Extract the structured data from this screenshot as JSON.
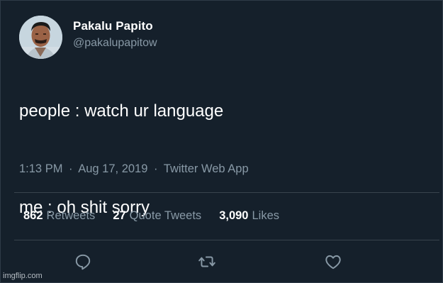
{
  "author": {
    "display_name": "Pakalu Papito",
    "handle": "@pakalupapitow"
  },
  "tweet": {
    "line1": "people : watch ur language",
    "line2": "me : oh shit sorry"
  },
  "meta": {
    "time": "1:13 PM",
    "separator": "·",
    "date": "Aug 17, 2019",
    "source": "Twitter Web App"
  },
  "stats": {
    "retweets_count": "862",
    "retweets_label": "Retweets",
    "quotes_count": "27",
    "quotes_label": "Quote Tweets",
    "likes_count": "3,090",
    "likes_label": "Likes"
  },
  "actions": {
    "reply_icon": "reply-icon",
    "retweet_icon": "retweet-icon",
    "like_icon": "heart-icon"
  },
  "colors": {
    "background": "#15202b",
    "secondary_text": "#8899a6",
    "divider": "#38444d"
  },
  "watermark": "imgflip.com"
}
